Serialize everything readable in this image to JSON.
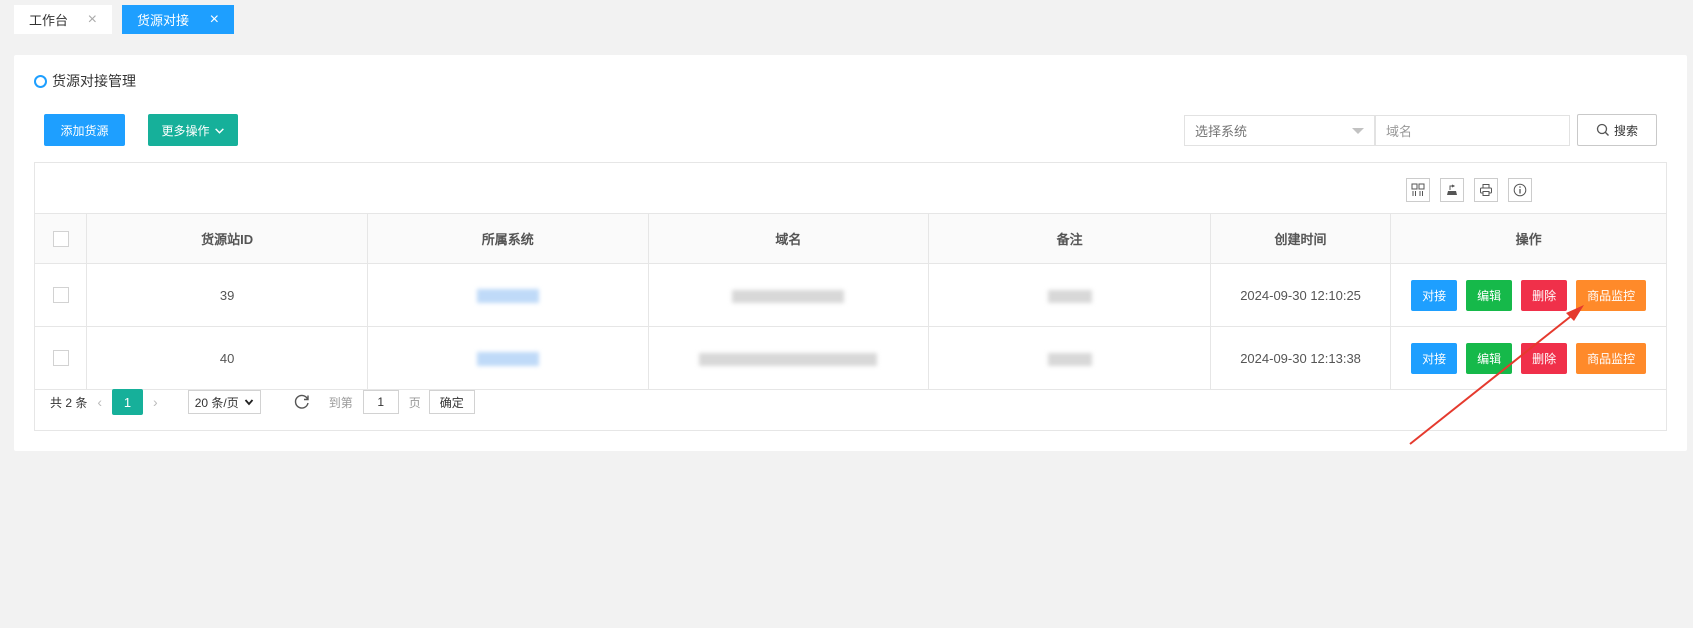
{
  "tabs": [
    {
      "label": "工作台",
      "active": false
    },
    {
      "label": "货源对接",
      "active": true
    }
  ],
  "card": {
    "title": "货源对接管理"
  },
  "toolbar": {
    "add_label": "添加货源",
    "more_label": "更多操作",
    "select_placeholder": "选择系统",
    "domain_placeholder": "域名",
    "search_label": "搜索"
  },
  "table": {
    "columns": [
      "货源站ID",
      "所属系统",
      "域名",
      "备注",
      "创建时间",
      "操作"
    ],
    "rows": [
      {
        "id": "39",
        "created": "2024-09-30 12:10:25"
      },
      {
        "id": "40",
        "created": "2024-09-30 12:13:38"
      }
    ],
    "actions": {
      "connect": "对接",
      "edit": "编辑",
      "delete": "删除",
      "monitor": "商品监控"
    }
  },
  "pager": {
    "total": "共 2 条",
    "current": "1",
    "page_size": "20 条/页",
    "goto_label": "到第",
    "goto_value": "1",
    "page_unit": "页",
    "confirm": "确定"
  },
  "colors": {
    "primary": "#1e9fff",
    "teal": "#16b09a",
    "green": "#16b94a",
    "red": "#f0304a",
    "orange": "#ff8a2a",
    "annotation_arrow": "#e53a2e"
  }
}
